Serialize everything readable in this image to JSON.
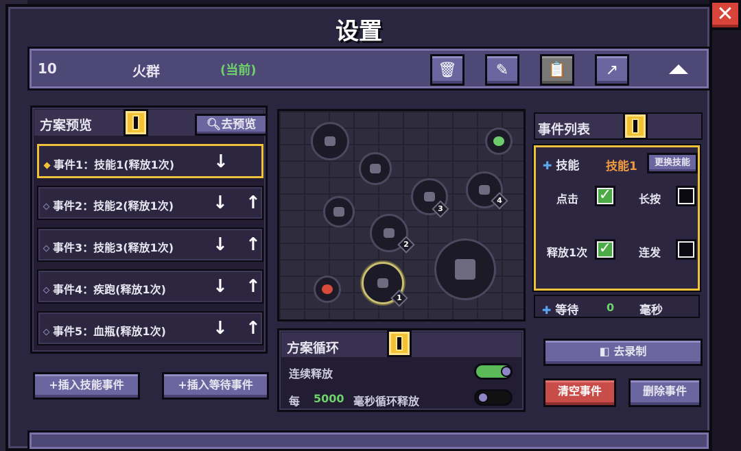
{
  "window": {
    "title": "设置",
    "close_label": "✕"
  },
  "scheme": {
    "number": "10",
    "name": "火群",
    "current_tag": "(当前)"
  },
  "scheme_buttons": [
    "trash-icon",
    "eraser-icon",
    "clipboard-icon",
    "export-icon"
  ],
  "preview": {
    "title": "方案预览",
    "preview_button": "去预览",
    "events": [
      {
        "label": "事件1：技能1(释放1次)"
      },
      {
        "label": "事件2：技能2(释放1次)"
      },
      {
        "label": "事件3：技能3(释放1次)"
      },
      {
        "label": "事件4：疾跑(释放1次)"
      },
      {
        "label": "事件5：血瓶(释放1次)"
      }
    ],
    "insert_skill_button": "+插入技能事件",
    "insert_wait_button": "+插入等待事件"
  },
  "map": {
    "node_tags": [
      "1",
      "2",
      "3",
      "4"
    ]
  },
  "loop": {
    "title": "方案循环",
    "continuous_label": "连续释放",
    "continuous_on": true,
    "every_label": "每",
    "interval_ms": "5000",
    "interval_suffix": "毫秒循环释放",
    "interval_on": false
  },
  "event_list": {
    "title": "事件列表",
    "skill_label": "技能",
    "skill_value": "技能1",
    "swap_button": "更换技能",
    "click_label": "点击",
    "click_checked": true,
    "hold_label": "长按",
    "hold_checked": false,
    "once_label": "释放1次",
    "once_checked": true,
    "burst_label": "连发",
    "burst_checked": false,
    "wait_label": "等待",
    "wait_value": "0",
    "wait_unit": "毫秒"
  },
  "actions": {
    "record_button": "去录制",
    "clear_button": "清空事件",
    "delete_button": "删除事件"
  },
  "colors": {
    "accent": "#f0c13b",
    "active_green": "#6dd36b",
    "danger": "#c84c48",
    "button": "#6c66a0"
  }
}
